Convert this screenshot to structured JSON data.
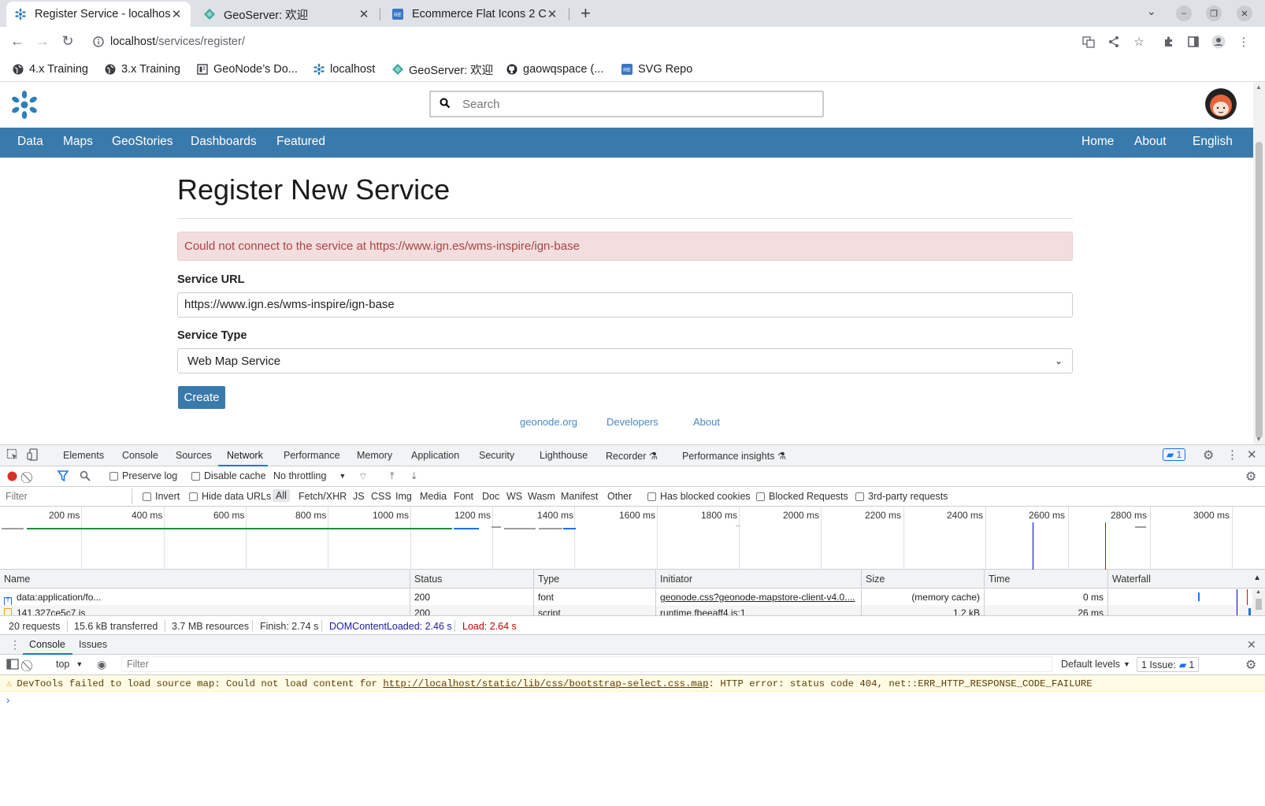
{
  "browser": {
    "tabs": [
      {
        "title": "Register Service - localhos",
        "icon": "geonode-icon"
      },
      {
        "title": "GeoServer: 欢迎",
        "icon": "geoserver-icon"
      },
      {
        "title": "Ecommerce Flat Icons 2 C",
        "icon": "svgrepo-icon"
      }
    ],
    "url_host": "localhost",
    "url_path": "/services/register/",
    "bookmarks": [
      {
        "label": "4.x Training",
        "icon": "globe-icon"
      },
      {
        "label": "3.x Training",
        "icon": "globe-icon"
      },
      {
        "label": "GeoNode’s Do...",
        "icon": "doc-icon"
      },
      {
        "label": "localhost",
        "icon": "geonode-icon"
      },
      {
        "label": "GeoServer: 欢迎",
        "icon": "geoserver-icon"
      },
      {
        "label": "gaowqspace (...",
        "icon": "github-icon"
      },
      {
        "label": "SVG Repo",
        "icon": "svgrepo-icon"
      }
    ]
  },
  "site": {
    "search_placeholder": "Search",
    "nav_left": [
      "Data",
      "Maps",
      "GeoStories",
      "Dashboards",
      "Featured"
    ],
    "nav_right": [
      "Home",
      "About",
      "English"
    ],
    "brand_color": "#397aac"
  },
  "form": {
    "title": "Register New Service",
    "error": "Could not connect to the service at https://www.ign.es/wms-inspire/ign-base",
    "url_label": "Service URL",
    "url_value": "https://www.ign.es/wms-inspire/ign-base",
    "type_label": "Service Type",
    "type_value": "Web Map Service",
    "create_label": "Create"
  },
  "footer": [
    "geonode.org",
    "Developers",
    "About"
  ],
  "devtools": {
    "tabs": [
      "Elements",
      "Console",
      "Sources",
      "Network",
      "Performance",
      "Memory",
      "Application",
      "Security",
      "Lighthouse",
      "Recorder",
      "Performance insights"
    ],
    "active_tab": "Network",
    "issues_badge": "1",
    "preserve_log": "Preserve log",
    "disable_cache": "Disable cache",
    "throttling": "No throttling",
    "filter_placeholder": "Filter",
    "invert": "Invert",
    "hide_data_urls": "Hide data URLs",
    "types": [
      "All",
      "Fetch/XHR",
      "JS",
      "CSS",
      "Img",
      "Media",
      "Font",
      "Doc",
      "WS",
      "Wasm",
      "Manifest",
      "Other"
    ],
    "blocked_cookies": "Has blocked cookies",
    "blocked_requests": "Blocked Requests",
    "third_party": "3rd-party requests",
    "timeline_ticks": [
      "200 ms",
      "400 ms",
      "600 ms",
      "800 ms",
      "1000 ms",
      "1200 ms",
      "1400 ms",
      "1600 ms",
      "1800 ms",
      "2000 ms",
      "2200 ms",
      "2400 ms",
      "2600 ms",
      "2800 ms",
      "3000 ms"
    ],
    "columns": [
      "Name",
      "Status",
      "Type",
      "Initiator",
      "Size",
      "Time",
      "Waterfall"
    ],
    "rows": [
      {
        "name": "data:application/fo...",
        "status": "200",
        "type": "font",
        "initiator": "geonode.css?geonode-mapstore-client-v4.0....",
        "size": "(memory cache)",
        "time": "0 ms"
      },
      {
        "name": "141.327ce5c7.js",
        "status": "200",
        "type": "script",
        "initiator": "runtime.fbeeaff4.js:1",
        "size": "1.2 kB",
        "time": "26 ms"
      }
    ],
    "summary": {
      "requests": "20 requests",
      "transferred": "15.6 kB transferred",
      "resources": "3.7 MB resources",
      "finish": "Finish: 2.74 s",
      "dom": "DOMContentLoaded: 2.46 s",
      "load": "Load: 2.64 s"
    },
    "drawer_tabs": [
      "Console",
      "Issues"
    ],
    "context": "top",
    "console_filter": "Filter",
    "levels": "Default levels",
    "issues_count": "1 Issue:",
    "issues_num": "1",
    "warning_pre": "DevTools failed to load source map: Could not load content for ",
    "warning_link": "http://localhost/static/lib/css/bootstrap-select.css.map",
    "warning_post": ": HTTP error: status code 404, net::ERR_HTTP_RESPONSE_CODE_FAILURE"
  }
}
